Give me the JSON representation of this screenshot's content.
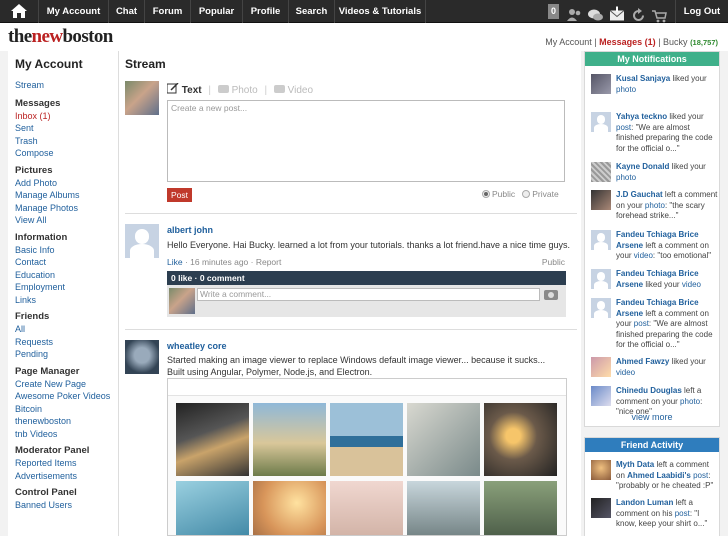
{
  "nav": {
    "items": [
      "My Account",
      "Chat",
      "Forum",
      "Popular",
      "Profile",
      "Search",
      "Videos & Tutorials"
    ],
    "badge": "0",
    "logout": "Log Out"
  },
  "header": {
    "logo_a": "the",
    "logo_b": "new",
    "logo_c": "boston",
    "my_account": "My Account",
    "messages": "Messages (1)",
    "user": "Bucky",
    "points": "(18,757)"
  },
  "left": {
    "title": "My Account",
    "stream": "Stream",
    "sections": [
      {
        "h": "Messages",
        "items": [
          "Inbox (1)",
          "Sent",
          "Trash",
          "Compose"
        ]
      },
      {
        "h": "Pictures",
        "items": [
          "Add Photo",
          "Manage Albums",
          "Manage Photos",
          "View All"
        ]
      },
      {
        "h": "Information",
        "items": [
          "Basic Info",
          "Contact",
          "Education",
          "Employment",
          "Links"
        ]
      },
      {
        "h": "Friends",
        "items": [
          "All",
          "Requests",
          "Pending"
        ]
      },
      {
        "h": "Page Manager",
        "items": [
          "Create New Page",
          "Awesome Poker Videos",
          "Bitcoin",
          "thenewboston",
          "tnb Videos"
        ]
      },
      {
        "h": "Moderator Panel",
        "items": [
          "Reported Items",
          "Advertisements"
        ]
      },
      {
        "h": "Control Panel",
        "items": [
          "Banned Users"
        ]
      }
    ]
  },
  "stream": {
    "title": "Stream",
    "tab_text": "Text",
    "tab_photo": "Photo",
    "tab_video": "Video",
    "placeholder": "Create a new post...",
    "post_btn": "Post",
    "public": "Public",
    "private": "Private"
  },
  "posts": [
    {
      "name": "albert john",
      "text": "Hello Everyone. Hai Bucky. learned a lot from your tutorials. thanks a lot friend.have a nice time guys.",
      "like": "Like",
      "time": "16 minutes ago",
      "report": "Report",
      "privacy": "Public",
      "likebar": "0 like · 0 comment",
      "comment_ph": "Write a comment..."
    },
    {
      "name": "wheatley core",
      "text1": "Started making an image viewer to replace Windows default image viewer... because it sucks...",
      "text2": "Built using Angular, Polymer, Node.js, and Electron."
    }
  ],
  "notifications": {
    "title": "My Notifications",
    "view_more": "view more",
    "items": [
      {
        "name": "Kusal Sanjaya",
        "act": "liked your",
        "obj": "photo"
      },
      {
        "name": "Yahya teckno",
        "act": "liked your",
        "obj": "post",
        "quote": "\"We are almost finished preparing the code for the official o...\""
      },
      {
        "name": "Kayne Donald",
        "act": "liked your",
        "obj": "photo"
      },
      {
        "name": "J.D Gauchat",
        "act": "left a comment on your",
        "obj": "photo",
        "quote": "\"the scary forehead strike...\""
      },
      {
        "name": "Fandeu Tchiaga Brice Arsene",
        "act": "left a comment on your",
        "obj": "video",
        "quote": "\"too emotional\""
      },
      {
        "name": "Fandeu Tchiaga Brice Arsene",
        "act": "liked your",
        "obj": "video"
      },
      {
        "name": "Fandeu Tchiaga Brice Arsene",
        "act": "left a comment on your",
        "obj": "post",
        "quote": "\"We are almost finished preparing the code for the official o...\""
      },
      {
        "name": "Ahmed Fawzy",
        "act": "liked your",
        "obj": "video"
      },
      {
        "name": "Chinedu Douglas",
        "act": "left a comment on your",
        "obj": "photo",
        "quote": "\"nice one\""
      }
    ]
  },
  "friends": {
    "title": "Friend Activity",
    "items": [
      {
        "name": "Myth Data",
        "text": "left a comment on",
        "target": "Ahmed Laabidi's",
        "obj": "post",
        "quote": "\"probably or he cheated :P\""
      },
      {
        "name": "Landon Luman",
        "text": "left a comment on his",
        "obj": "post",
        "quote": "\"I know, keep your shirt o...\""
      }
    ]
  },
  "colors": {
    "topbar": "#2a2a2a",
    "accent_red": "#c0392b",
    "notif_header": "#3fb08a",
    "friend_header": "#2f7dbd",
    "likebar": "#2c3e50"
  }
}
